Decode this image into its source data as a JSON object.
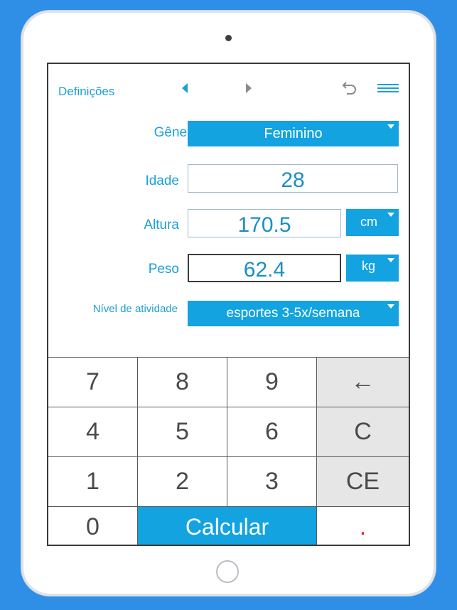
{
  "toolbar": {
    "settings_label": "Definições"
  },
  "form": {
    "gender": {
      "label": "Gênero",
      "value": "Feminino"
    },
    "age": {
      "label": "Idade",
      "value": "28"
    },
    "height": {
      "label": "Altura",
      "value": "170.5",
      "unit": "cm"
    },
    "weight": {
      "label": "Peso",
      "value": "62.4",
      "unit": "kg"
    },
    "activity": {
      "label": "Nível de atividade",
      "value": "esportes 3-5x/semana"
    }
  },
  "keypad": {
    "k7": "7",
    "k8": "8",
    "k9": "9",
    "backspace": "←",
    "k4": "4",
    "k5": "5",
    "k6": "6",
    "clear": "C",
    "k1": "1",
    "k2": "2",
    "k3": "3",
    "clear_entry": "CE",
    "k0": "0",
    "calculate": "Calcular",
    "decimal": "."
  },
  "colors": {
    "accent": "#12a3e0",
    "background": "#2f8fe6",
    "decimal_key": "#e02020"
  }
}
